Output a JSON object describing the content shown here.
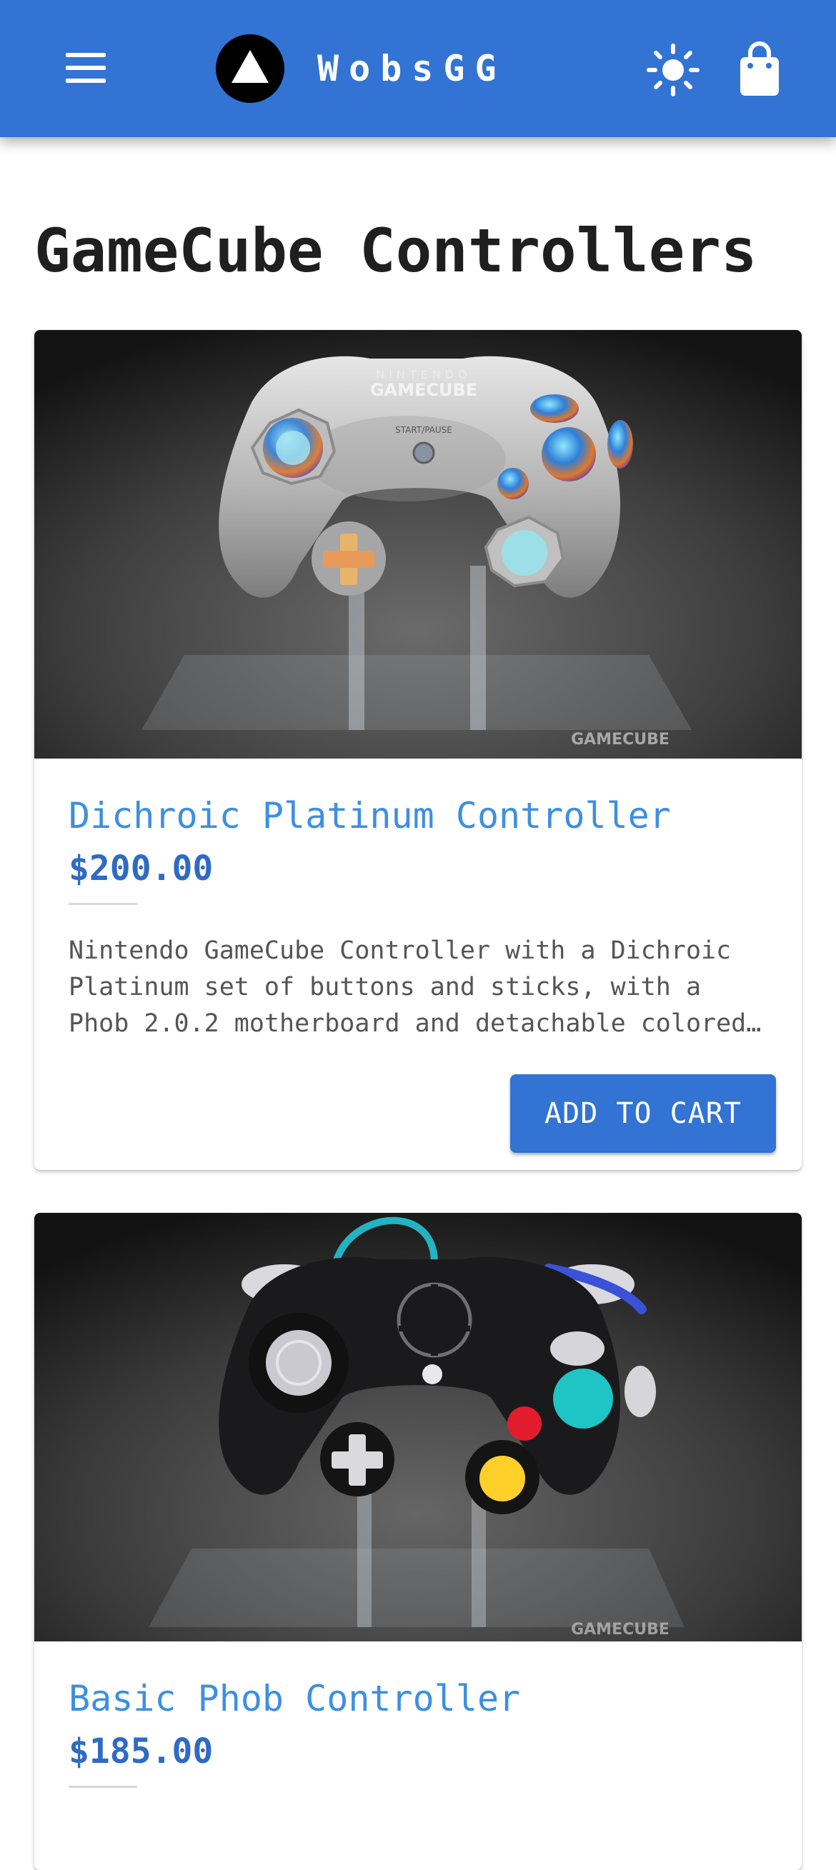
{
  "app_bar": {
    "brand": "WobsGG",
    "menu_icon": "menu-icon",
    "logo_icon": "triangle-logo-icon",
    "theme_icon": "sun-icon",
    "cart_icon": "shopping-bag-icon",
    "background_color": "#3273d3"
  },
  "page": {
    "title": "GameCube Controllers"
  },
  "products": [
    {
      "title": "Dichroic Platinum Controller",
      "price": "$200.00",
      "description": "Nintendo GameCube Controller with a Dichroic Platinum set of buttons and sticks, with a Phob 2.0.2 motherboard and detachable colored cable.",
      "button_label": "ADD TO CART",
      "image_watermark": "GAMECUBE",
      "controller_logo": "NINTENDO GAMECUBE",
      "start_label": "START/PAUSE"
    },
    {
      "title": "Basic Phob Controller",
      "price": "$185.00",
      "image_watermark": "GAMECUBE"
    }
  ],
  "colors": {
    "accent": "#3273d3",
    "title_link": "#3d8fe0",
    "price": "#2f6bc4"
  }
}
